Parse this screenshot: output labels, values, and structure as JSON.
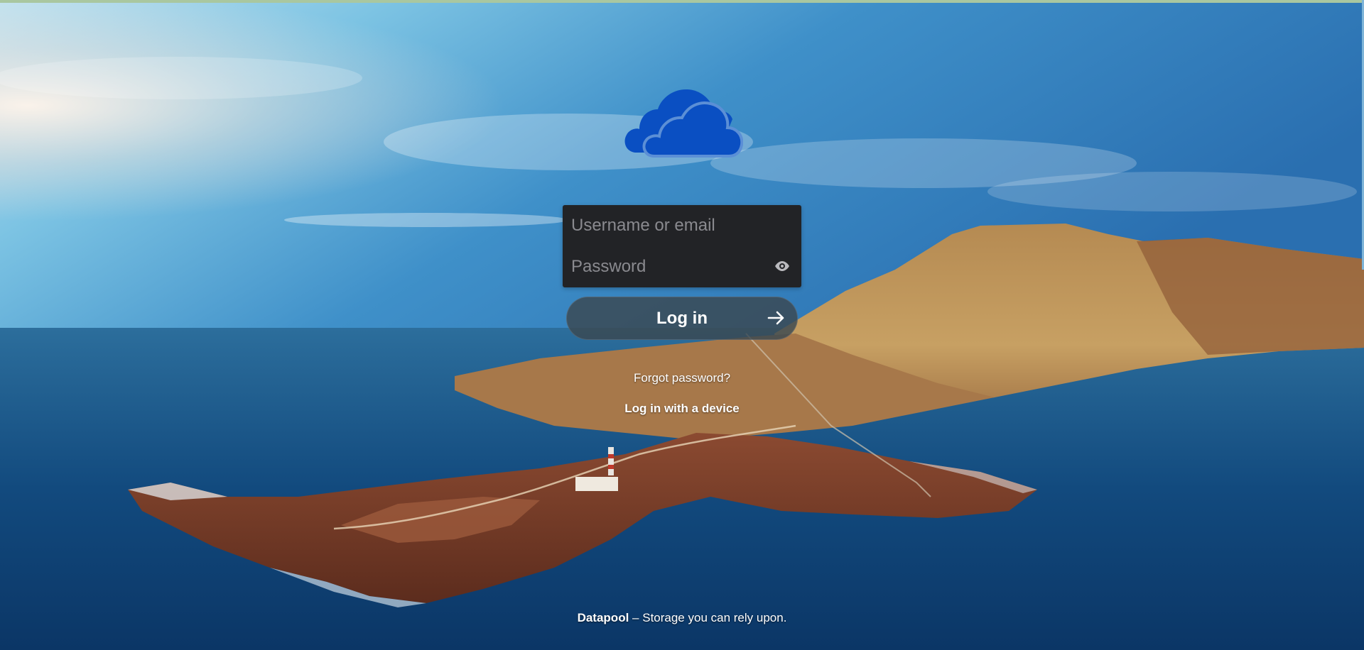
{
  "login": {
    "username_placeholder": "Username or email",
    "password_placeholder": "Password",
    "submit_label": "Log in",
    "forgot_password": "Forgot password?",
    "device_login": "Log in with a device"
  },
  "footer": {
    "brand": "Datapool",
    "tagline": "– Storage you can rely upon."
  },
  "icons": {
    "logo": "cloud-logo-icon",
    "password_toggle": "eye-icon",
    "submit": "arrow-right-icon"
  },
  "colors": {
    "logo_blue": "#0a4fc2",
    "login_box": "#222326",
    "button": "#3a4850"
  }
}
